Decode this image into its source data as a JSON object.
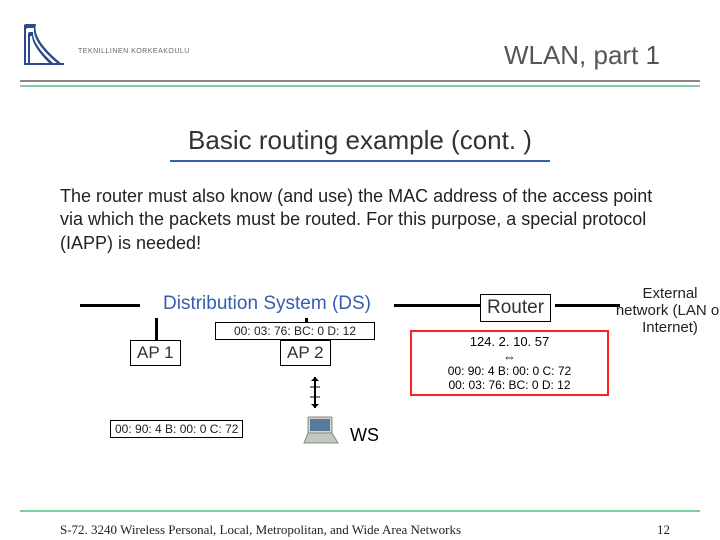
{
  "header": {
    "logo_text": "TEKNILLINEN KORKEAKOULU",
    "title": "WLAN, part 1"
  },
  "slide": {
    "title": "Basic routing example (cont. )",
    "paragraph": "The router must also know (and use) the MAC address of the access point via which the packets must be routed. For this purpose, a special protocol (IAPP) is needed!"
  },
  "diagram": {
    "ds_label": "Distribution System (DS)",
    "router_label": "Router",
    "ap1_label": "AP 1",
    "ap2_label": "AP 2",
    "ap2_mac": "00: 03: 76: BC: 0 D: 12",
    "ws_label": "WS",
    "ws_mac": "00: 90: 4 B: 00: 0 C: 72",
    "router_ip": "124. 2. 10. 57",
    "router_arrow": "⇔",
    "mapping_line1": "00: 90: 4 B: 00: 0 C: 72",
    "mapping_line2": "00: 03: 76: BC: 0 D: 12",
    "external_text": "External network (LAN or Internet)"
  },
  "footer": {
    "course": "S-72. 3240 Wireless Personal, Local, Metropolitan, and Wide Area Networks",
    "page": "12"
  }
}
